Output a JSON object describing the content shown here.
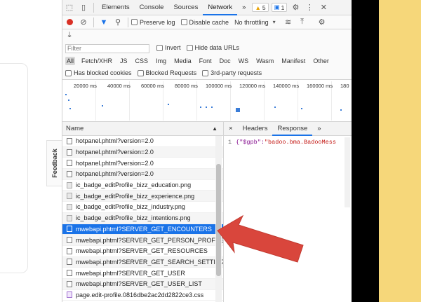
{
  "page": {
    "feedback_label": "Feedback"
  },
  "toolbar": {
    "tabs": [
      "Elements",
      "Console",
      "Sources",
      "Network"
    ],
    "more": "»",
    "warnings_count": "5",
    "messages_count": "1"
  },
  "network_toolbar": {
    "preserve_log": "Preserve log",
    "disable_cache": "Disable cache",
    "throttling": "No throttling"
  },
  "filters": {
    "placeholder": "Filter",
    "invert": "Invert",
    "hide_data_urls": "Hide data URLs",
    "types": [
      "All",
      "Fetch/XHR",
      "JS",
      "CSS",
      "Img",
      "Media",
      "Font",
      "Doc",
      "WS",
      "Wasm",
      "Manifest",
      "Other"
    ],
    "blocked_cookies": "Has blocked cookies",
    "blocked_requests": "Blocked Requests",
    "third_party": "3rd-party requests"
  },
  "overview": {
    "ticks": [
      "20000 ms",
      "40000 ms",
      "60000 ms",
      "80000 ms",
      "100000 ms",
      "120000 ms",
      "140000 ms",
      "160000 ms",
      "180"
    ]
  },
  "requests": {
    "header": "Name",
    "rows": [
      {
        "name": "hotpanel.phtml?version=2.0",
        "type": "doc"
      },
      {
        "name": "hotpanel.phtml?version=2.0",
        "type": "doc"
      },
      {
        "name": "hotpanel.phtml?version=2.0",
        "type": "doc"
      },
      {
        "name": "hotpanel.phtml?version=2.0",
        "type": "doc"
      },
      {
        "name": "ic_badge_editProfile_bizz_education.png",
        "type": "img"
      },
      {
        "name": "ic_badge_editProfile_bizz_experience.png",
        "type": "img"
      },
      {
        "name": "ic_badge_editProfile_bizz_industry.png",
        "type": "img"
      },
      {
        "name": "ic_badge_editProfile_bizz_intentions.png",
        "type": "img"
      },
      {
        "name": "mwebapi.phtml?SERVER_GET_ENCOUNTERS",
        "type": "doc"
      },
      {
        "name": "mwebapi.phtml?SERVER_GET_PERSON_PROFILE_E...",
        "type": "doc"
      },
      {
        "name": "mwebapi.phtml?SERVER_GET_RESOURCES",
        "type": "doc"
      },
      {
        "name": "mwebapi.phtml?SERVER_GET_SEARCH_SETTINGS",
        "type": "doc"
      },
      {
        "name": "mwebapi.phtml?SERVER_GET_USER",
        "type": "doc"
      },
      {
        "name": "mwebapi.phtml?SERVER_GET_USER_LIST",
        "type": "doc"
      },
      {
        "name": "page.edit-profile.0816dbe2ac2dd2822ce3.css",
        "type": "css"
      }
    ],
    "selected_index": 8
  },
  "detail": {
    "close": "×",
    "tabs": [
      "Headers",
      "Response"
    ],
    "more": "»",
    "line_number": "1",
    "response_prefix": "{\"$gpb\":",
    "response_value": "\"badoo.bma.BadooMess"
  },
  "colors": {
    "accent": "#1a73e8",
    "annotation_arrow": "#d9463c",
    "page_yellow": "#f6d77a"
  }
}
